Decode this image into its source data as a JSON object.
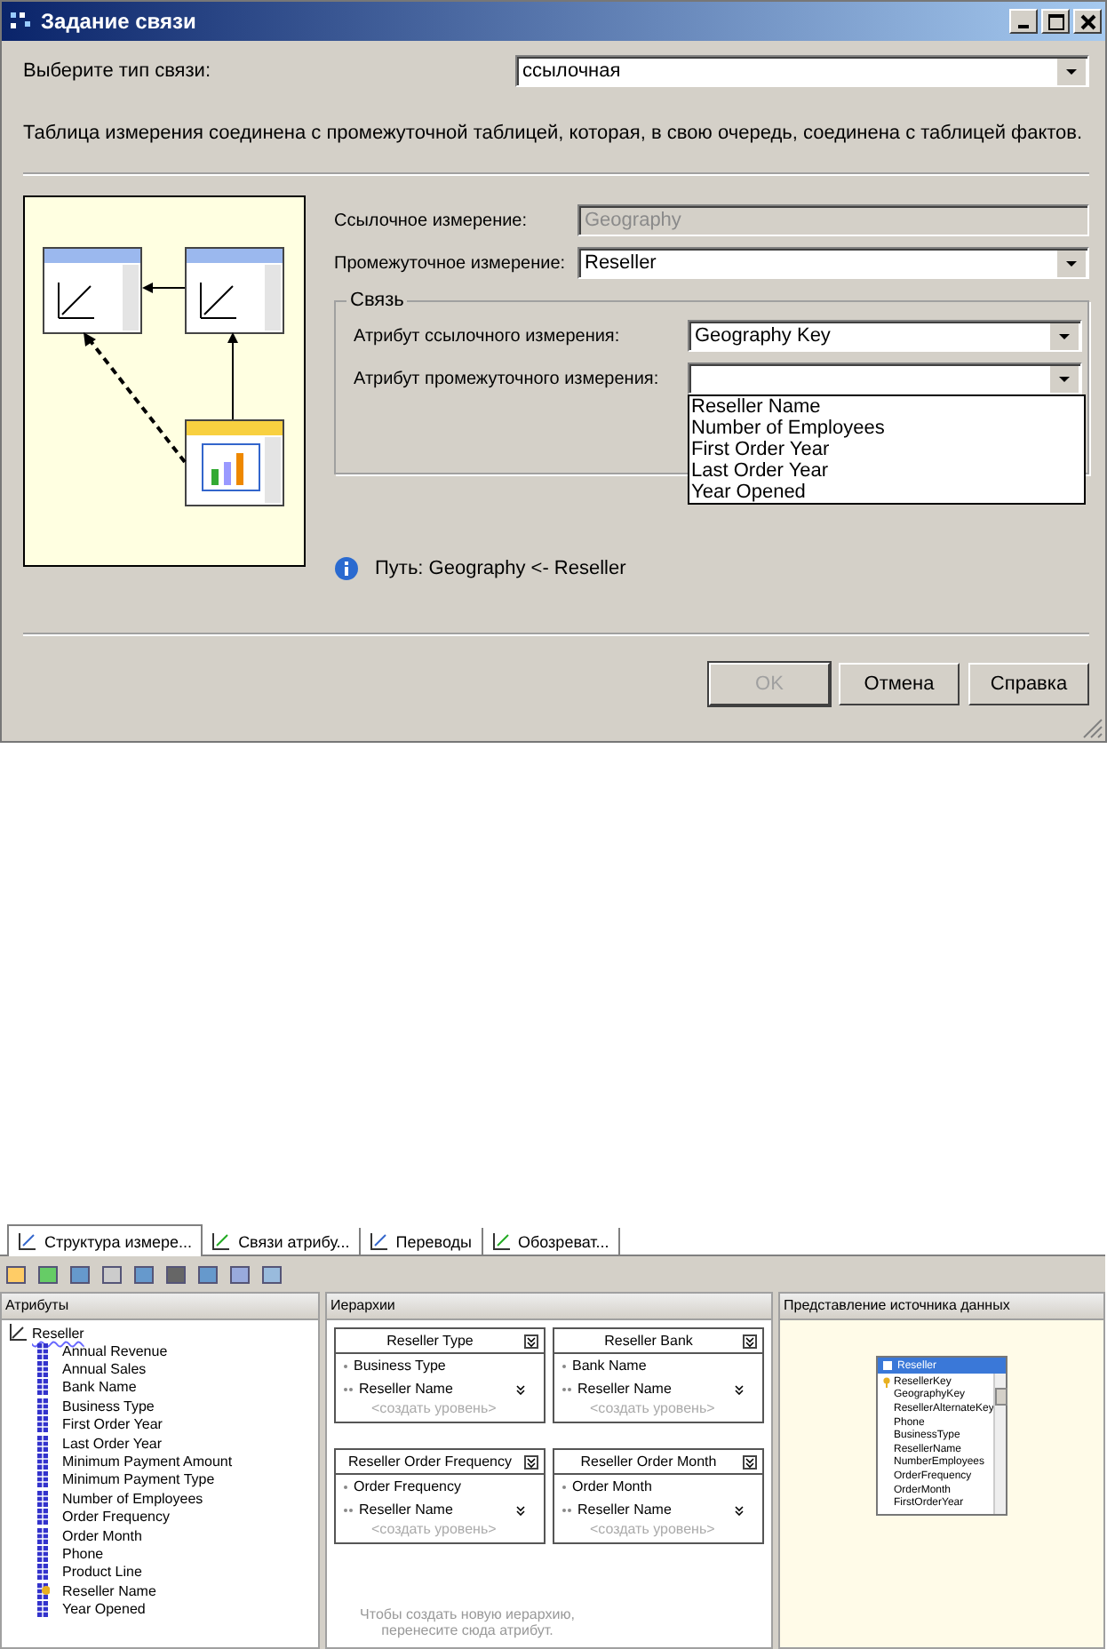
{
  "dialog": {
    "title": "Задание связи",
    "type_label": "Выберите тип связи:",
    "type_value": "ссылочная",
    "description": "Таблица измерения соединена с промежуточной таблицей, которая, в свою очередь, соединена с таблицей фактов.",
    "reference_label": "Ссылочное измерение:",
    "reference_value": "Geography",
    "reference_disabled": true,
    "intermediate_label": "Промежуточное измерение:",
    "intermediate_value": "Reseller",
    "group_title": "Связь",
    "ref_attr_label": "Атрибут ссылочного измерения:",
    "ref_attr_value": "Geography Key",
    "int_attr_label": "Атрибут промежуточного измерения:",
    "int_attr_expanded": true,
    "int_attr_options": [
      "Reseller Name",
      "Number of Employees",
      "First Order Year",
      "Last Order Year",
      "Year Opened"
    ],
    "path_text": "Путь: Geography <- Reseller",
    "buttons": [
      {
        "label": "OK",
        "disabled": true
      },
      {
        "label": "Отмена",
        "disabled": false
      },
      {
        "label": "Справка",
        "disabled": false
      }
    ]
  },
  "designer": {
    "tabs": [
      {
        "label": "Структура измере...",
        "selected": true
      },
      {
        "label": "Связи атрибу...",
        "selected": false
      },
      {
        "label": "Переводы",
        "selected": false
      },
      {
        "label": "Обозреват...",
        "selected": false
      }
    ],
    "attributes_panel": {
      "title": "Атрибуты",
      "dimension": "Reseller",
      "items": [
        {
          "name": "Annual Revenue",
          "kind": "attribute"
        },
        {
          "name": "Annual Sales",
          "kind": "attribute"
        },
        {
          "name": "Bank Name",
          "kind": "attribute"
        },
        {
          "name": "Business Type",
          "kind": "attribute"
        },
        {
          "name": "First Order Year",
          "kind": "attribute"
        },
        {
          "name": "Last Order Year",
          "kind": "attribute"
        },
        {
          "name": "Minimum Payment Amount",
          "kind": "attribute"
        },
        {
          "name": "Minimum Payment Type",
          "kind": "attribute"
        },
        {
          "name": "Number of Employees",
          "kind": "attribute"
        },
        {
          "name": "Order Frequency",
          "kind": "attribute"
        },
        {
          "name": "Order Month",
          "kind": "attribute"
        },
        {
          "name": "Phone",
          "kind": "attribute"
        },
        {
          "name": "Product Line",
          "kind": "attribute"
        },
        {
          "name": "Reseller Name",
          "kind": "key"
        },
        {
          "name": "Year Opened",
          "kind": "attribute"
        }
      ]
    },
    "hierarchies_panel": {
      "title": "Иерархии",
      "hierarchies": [
        {
          "name": "Reseller Type",
          "levels": [
            "Business Type",
            "Reseller Name"
          ],
          "new_level": "<создать уровень>"
        },
        {
          "name": "Reseller Bank",
          "levels": [
            "Bank Name",
            "Reseller Name"
          ],
          "new_level": "<создать уровень>"
        },
        {
          "name": "Reseller Order Frequency",
          "levels": [
            "Order Frequency",
            "Reseller Name"
          ],
          "new_level": "<создать уровень>"
        },
        {
          "name": "Reseller Order Month",
          "levels": [
            "Order Month",
            "Reseller Name"
          ],
          "new_level": "<создать уровень>"
        }
      ],
      "hint": "Чтобы создать новую иерархию, перенесите сюда атрибут."
    },
    "dsv_panel": {
      "title": "Представление источника данных",
      "table": {
        "name": "Reseller",
        "columns": [
          {
            "name": "ResellerKey",
            "kind": "key"
          },
          {
            "name": "GeographyKey",
            "kind": "column"
          },
          {
            "name": "ResellerAlternateKey",
            "kind": "column"
          },
          {
            "name": "Phone",
            "kind": "column"
          },
          {
            "name": "BusinessType",
            "kind": "column"
          },
          {
            "name": "ResellerName",
            "kind": "column"
          },
          {
            "name": "NumberEmployees",
            "kind": "column"
          },
          {
            "name": "OrderFrequency",
            "kind": "column"
          },
          {
            "name": "OrderMonth",
            "kind": "column"
          },
          {
            "name": "FirstOrderYear",
            "kind": "column"
          }
        ]
      }
    }
  }
}
